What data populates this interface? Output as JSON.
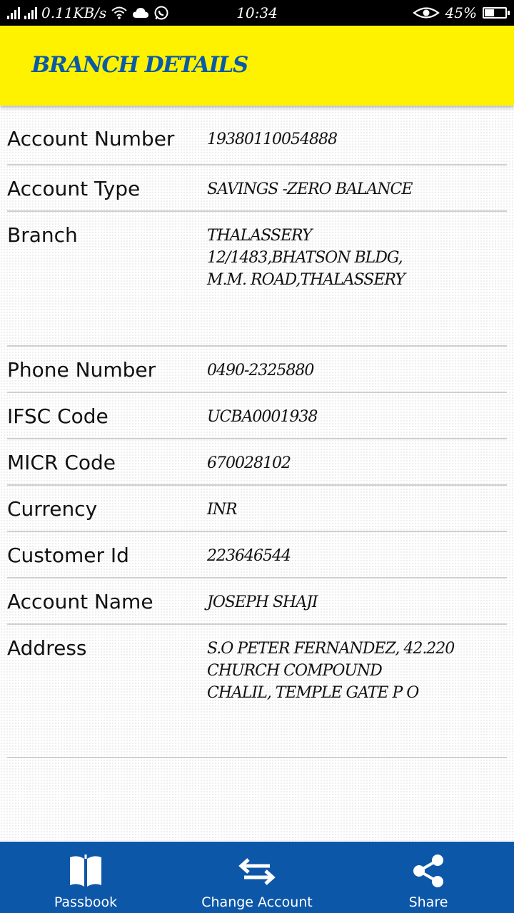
{
  "status_bar": {
    "net_speed": "0.11KB/s",
    "time": "10:34",
    "battery": "45%",
    "battery_level": 0.45,
    "icons": [
      "signal-icon",
      "signal-icon",
      "wifi-icon",
      "cloud-icon",
      "whatsapp-icon",
      "eye-icon",
      "battery-icon"
    ]
  },
  "header": {
    "title": "BRANCH DETAILS"
  },
  "details": [
    {
      "label": "Account Number",
      "value": [
        "19380110054888"
      ]
    },
    {
      "label": "Account Type",
      "value": [
        "SAVINGS -ZERO BALANCE"
      ]
    },
    {
      "label": "Branch",
      "value": [
        "THALASSERY",
        "12/1483,BHATSON BLDG,",
        "M.M. ROAD,THALASSERY"
      ]
    },
    {
      "label": "Phone Number",
      "value": [
        "0490-2325880"
      ]
    },
    {
      "label": "IFSC Code",
      "value": [
        "UCBA0001938"
      ]
    },
    {
      "label": "MICR Code",
      "value": [
        "670028102"
      ]
    },
    {
      "label": "Currency",
      "value": [
        "INR"
      ]
    },
    {
      "label": "Customer Id",
      "value": [
        "223646544"
      ]
    },
    {
      "label": "Account Name",
      "value": [
        "JOSEPH SHAJI"
      ]
    },
    {
      "label": "Address",
      "value": [
        "S.O PETER FERNANDEZ, 42.220 CHURCH COMPOUND",
        "CHALIL, TEMPLE GATE P O"
      ]
    }
  ],
  "bottom_nav": [
    {
      "label": "Passbook",
      "icon": "book-icon"
    },
    {
      "label": "Change Account",
      "icon": "swap-arrows-icon"
    },
    {
      "label": "Share",
      "icon": "share-icon"
    }
  ],
  "colors": {
    "header_bg": "#fff200",
    "title": "#0a5aa8",
    "nav_bg": "#0d57a8"
  }
}
